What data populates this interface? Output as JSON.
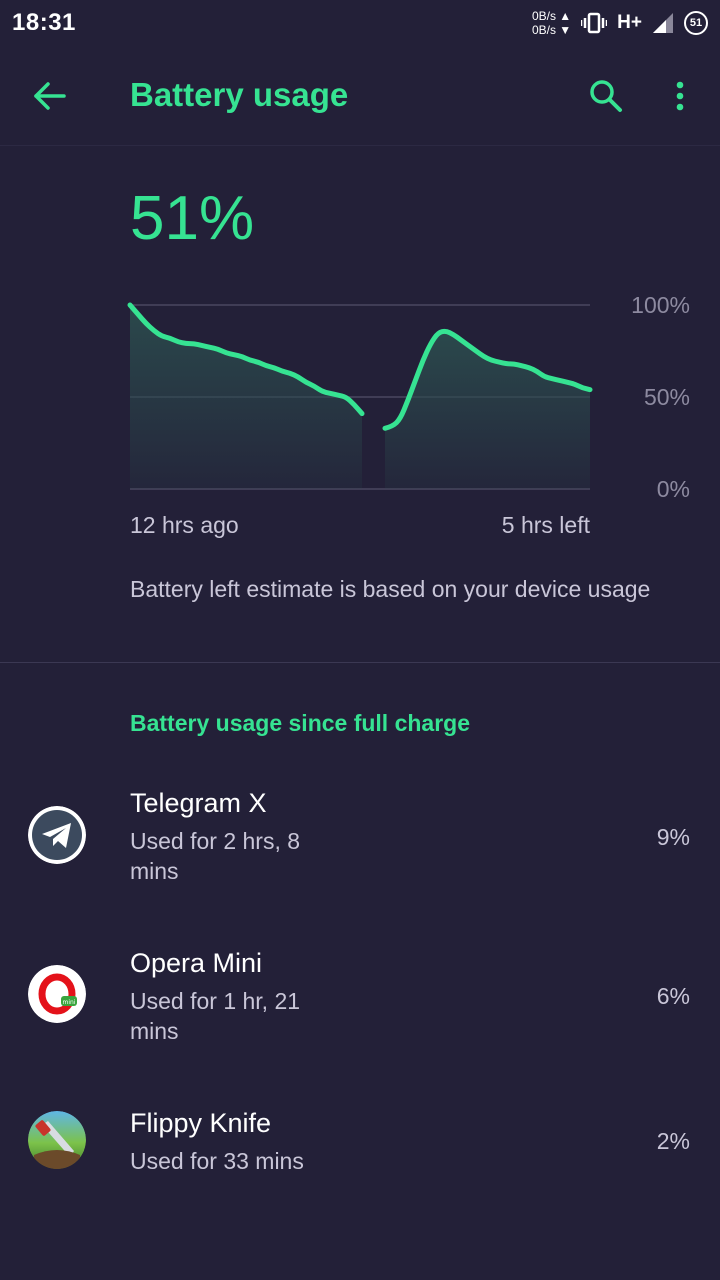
{
  "status_bar": {
    "time": "18:31",
    "net_up": "0B/s",
    "net_down": "0B/s",
    "network_type": "H+",
    "battery_level": "51",
    "icons": [
      "vibrate-icon",
      "signal-icon",
      "battery-icon"
    ]
  },
  "app_bar": {
    "title": "Battery usage",
    "icons": [
      "back-arrow-icon",
      "search-icon",
      "more-vert-icon"
    ],
    "accent_color": "#36e392"
  },
  "battery_level": "51%",
  "chart_data": {
    "type": "area",
    "y_ticks": [
      "100%",
      "50%",
      "0%"
    ],
    "ylim": [
      0,
      100
    ],
    "x_start_label": "12 hrs ago",
    "x_end_label": "5 hrs left",
    "grid": true,
    "series": [
      {
        "values_recorded": [
          100,
          95,
          90,
          86,
          83,
          82,
          80,
          79,
          79,
          78,
          77,
          76,
          74,
          73,
          72,
          70,
          69,
          67,
          66,
          64,
          63,
          61,
          58,
          56,
          53,
          52,
          51,
          50,
          46,
          41
        ],
        "values_estimated": [
          33,
          34,
          38,
          48,
          59,
          70,
          79,
          85,
          86,
          84,
          81,
          78,
          75,
          72,
          70,
          69,
          68,
          68,
          67,
          66,
          64,
          61,
          60,
          59,
          58,
          57,
          55,
          54
        ]
      }
    ],
    "line_color": "#36e392",
    "fill_color": "#2b4b4d"
  },
  "estimate_note": "Battery left estimate is based on your device usage",
  "section_title": "Battery usage since full charge",
  "apps": [
    {
      "name": "Telegram X",
      "usage": "Used for 2 hrs, 8 mins",
      "percent": "9%",
      "icon": "telegram-icon"
    },
    {
      "name": "Opera Mini",
      "usage": "Used for 1 hr, 21 mins",
      "percent": "6%",
      "icon": "opera-mini-icon"
    },
    {
      "name": "Flippy Knife",
      "usage": "Used for 33 mins",
      "percent": "2%",
      "icon": "flippy-knife-icon"
    }
  ]
}
